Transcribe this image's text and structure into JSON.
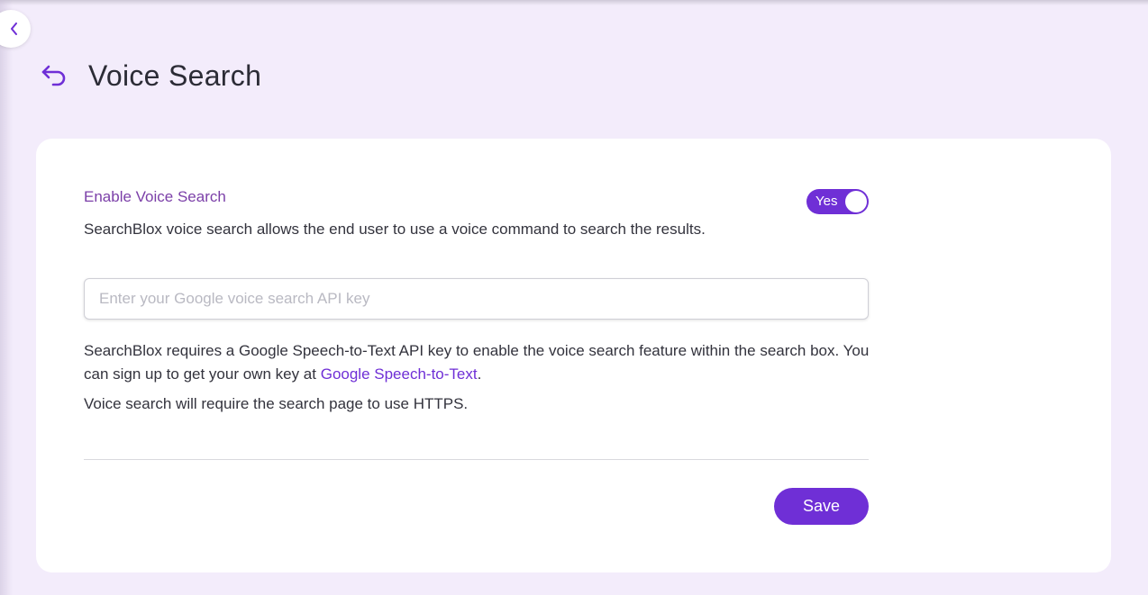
{
  "header": {
    "title": "Voice Search",
    "back_icon": "undo-arrow-icon",
    "collapse_icon": "chevron-left-icon"
  },
  "setting": {
    "label": "Enable Voice Search",
    "description": "SearchBlox voice search allows the end user to use a voice command to search the results.",
    "toggle_label": "Yes",
    "toggle_on": true
  },
  "api_key": {
    "value": "",
    "placeholder": "Enter your Google voice search API key"
  },
  "help": {
    "text_before_link": "SearchBlox requires a Google Speech-to-Text API key to enable the voice search feature within the search box. You can sign up to get your own key at ",
    "link_label": "Google Speech-to-Text",
    "text_after_link": ".",
    "https_note": "Voice search will require the search page to use HTTPS."
  },
  "actions": {
    "save_label": "Save"
  },
  "colors": {
    "accent": "#6f2fd6",
    "label": "#7b3fa8",
    "background": "#f3ecfb"
  }
}
